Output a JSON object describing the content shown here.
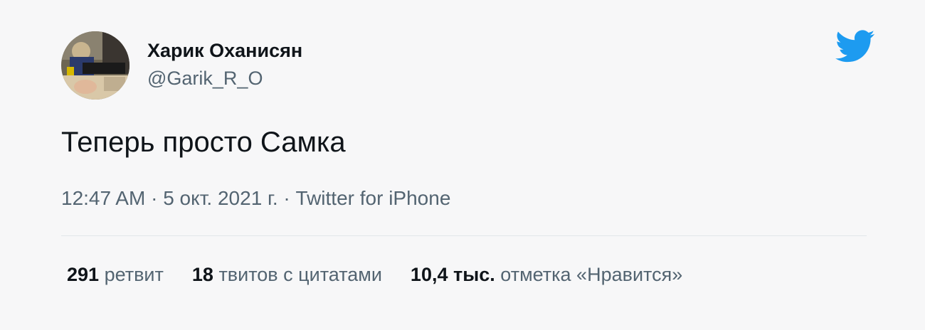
{
  "author": {
    "display_name": "Харик Оханисян",
    "handle": "@Garik_R_O"
  },
  "tweet": {
    "text": "Теперь просто Самка"
  },
  "meta": {
    "time": "12:47 AM",
    "separator": " · ",
    "date": "5 окт. 2021 г.",
    "source": "Twitter for iPhone"
  },
  "stats": {
    "retweets_count": "291",
    "retweets_label": "ретвит",
    "quotes_count": "18",
    "quotes_label": "твитов с цитатами",
    "likes_count": "10,4 тыс.",
    "likes_label": "отметка «Нравится»"
  },
  "colors": {
    "twitter_blue": "#1d9bf0",
    "text_primary": "#0f1419",
    "text_secondary": "#536471",
    "background": "#f7f7f8"
  },
  "icons": {
    "brand": "twitter-bird-icon"
  }
}
